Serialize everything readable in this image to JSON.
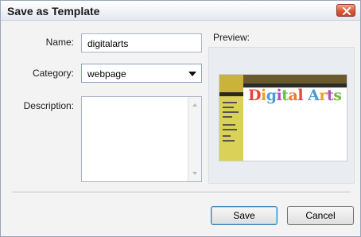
{
  "dialog": {
    "title": "Save as Template"
  },
  "form": {
    "name_label": "Name:",
    "name_value": "digitalarts",
    "category_label": "Category:",
    "category_value": "webpage",
    "description_label": "Description:",
    "description_value": ""
  },
  "preview": {
    "label": "Preview:",
    "thumbnail_text": "Digital Arts"
  },
  "buttons": {
    "save": "Save",
    "cancel": "Cancel"
  },
  "colors": {
    "close_button": "#d9583a",
    "default_button_border": "#3c7fb1",
    "preview_panel_bg": "#e9ecf1"
  },
  "icons": {
    "close": "close-icon",
    "dropdown": "chevron-down-icon"
  }
}
